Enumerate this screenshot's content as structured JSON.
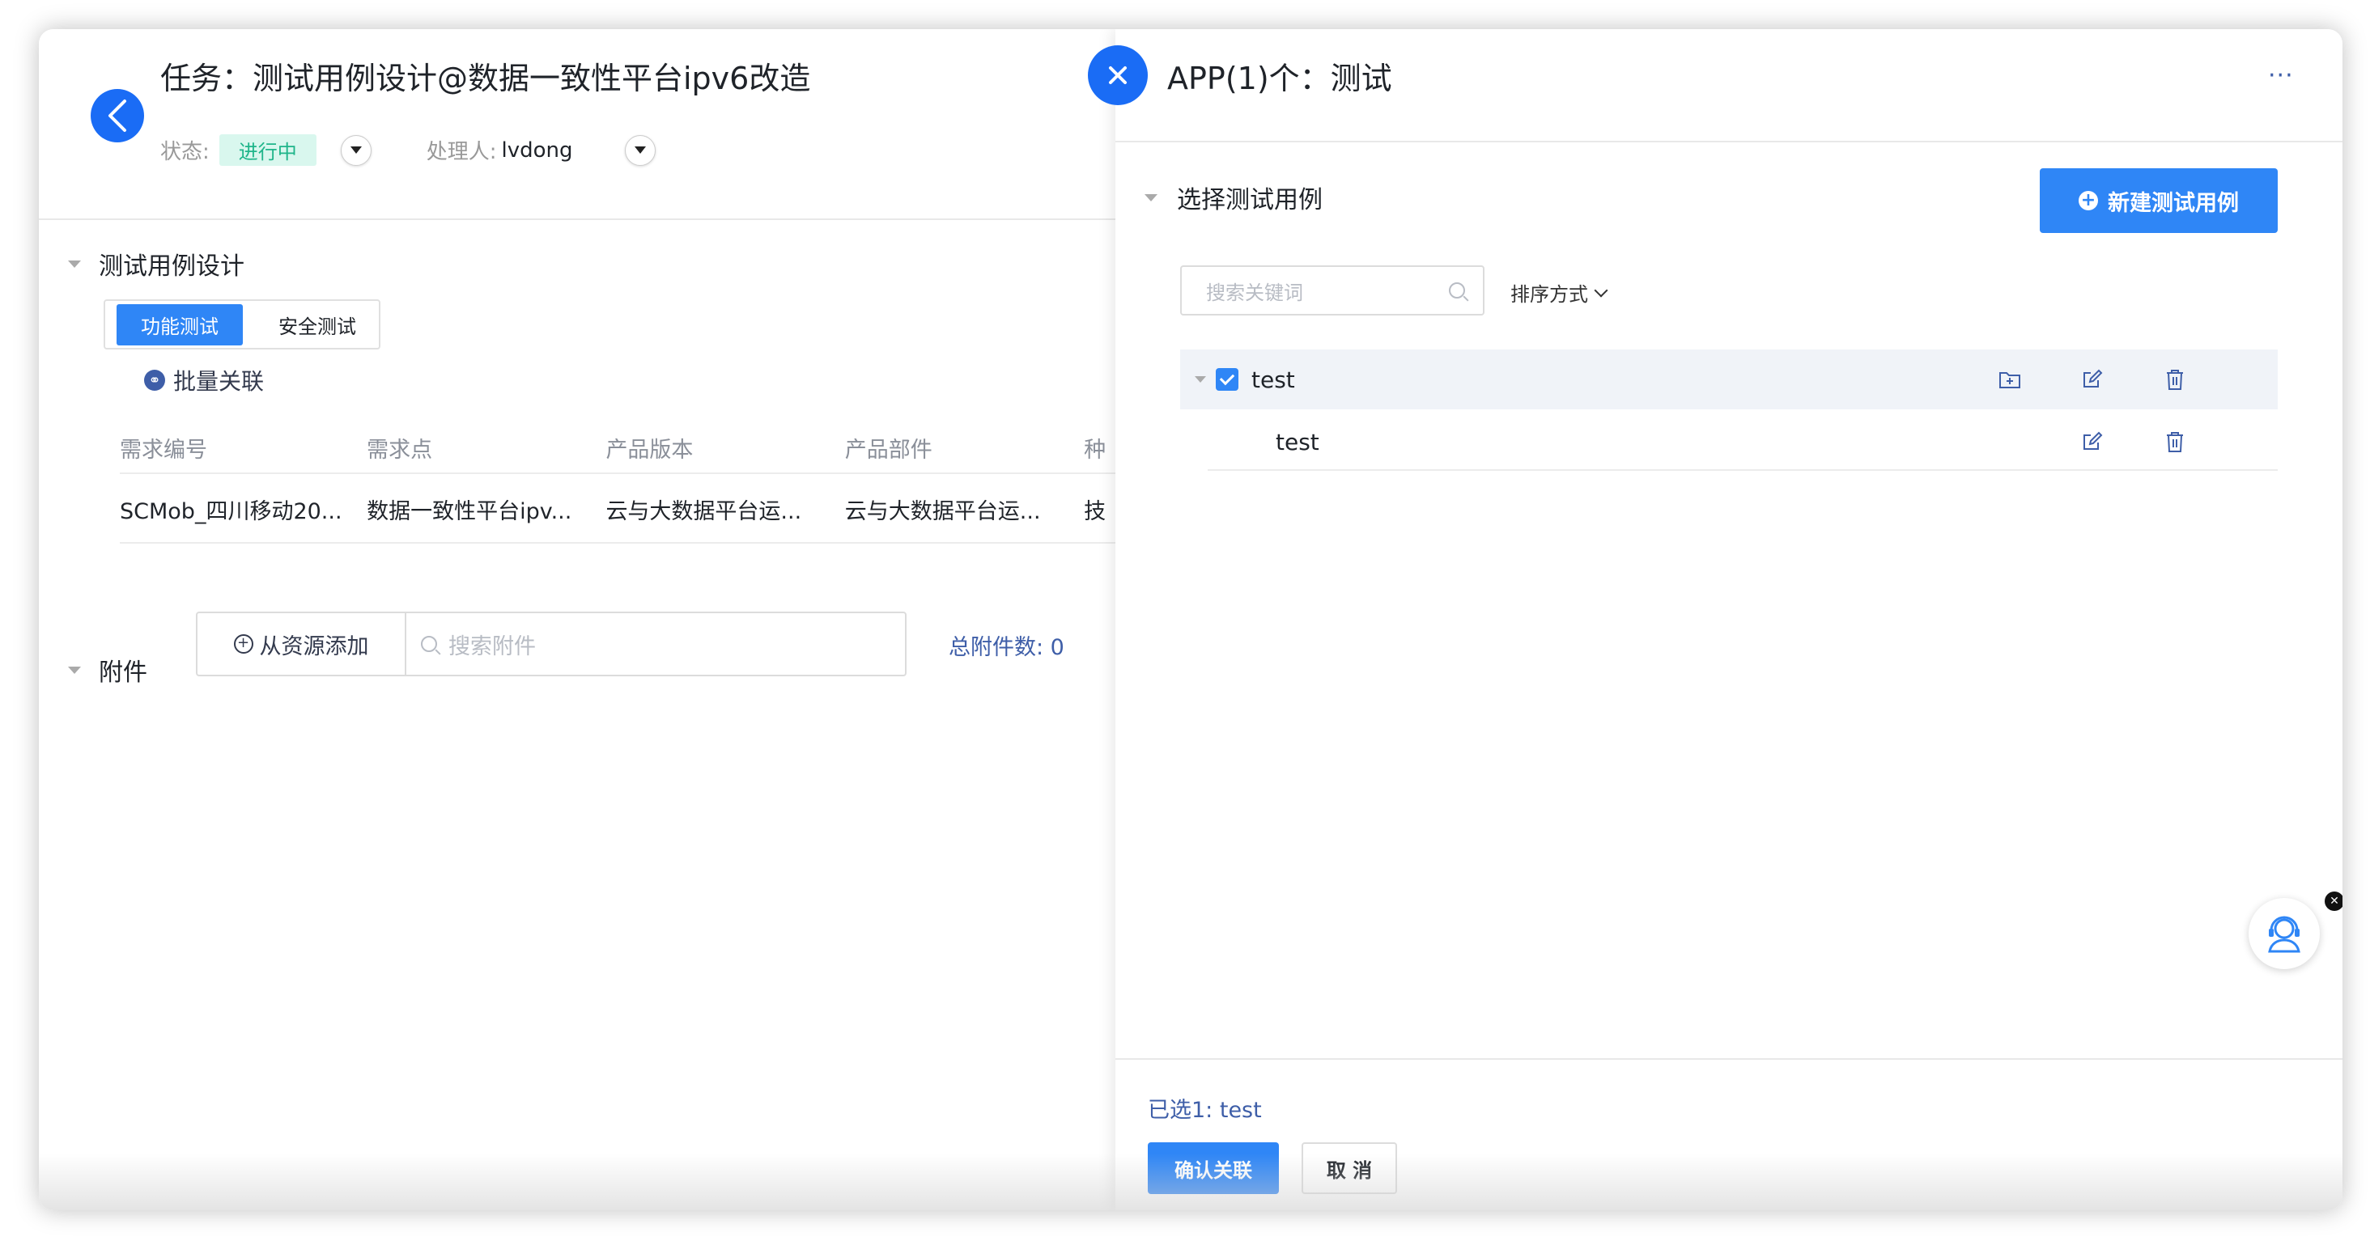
{
  "task": {
    "title": "任务：测试用例设计@数据一致性平台ipv6改造",
    "status_label": "状态:",
    "status_value": "进行中",
    "assignee_label": "处理人:",
    "assignee_value": "lvdong"
  },
  "design_section": {
    "title": "测试用例设计",
    "tabs": [
      "功能测试",
      "安全测试"
    ],
    "active_tab": "功能测试",
    "bulk_link": "批量关联",
    "table": {
      "headers": [
        "需求编号",
        "需求点",
        "产品版本",
        "产品部件",
        "种"
      ],
      "rows": [
        [
          "SCMob_四川移动20...",
          "数据一致性平台ipv...",
          "云与大数据平台运...",
          "云与大数据平台运...",
          "技"
        ]
      ]
    }
  },
  "attachment_section": {
    "title": "附件",
    "add_label": "从资源添加",
    "search_placeholder": "搜索附件",
    "count_label": "总附件数: 0"
  },
  "drawer": {
    "title": "APP(1)个：测试",
    "more_label": "···",
    "section_title": "选择测试用例",
    "new_button": "新建测试用例",
    "search_placeholder": "搜索关键词",
    "sort_label": "排序方式",
    "tree": {
      "parent_label": "test",
      "parent_checked": true,
      "child_label": "test"
    },
    "selected_label": "已选1:  test",
    "confirm_button": "确认关联",
    "cancel_button": "取 消"
  },
  "colors": {
    "accent": "#2f86f6",
    "close_button": "#1a6cf5",
    "status_bg": "#d9f7ee",
    "status_text": "#1fb58a"
  }
}
